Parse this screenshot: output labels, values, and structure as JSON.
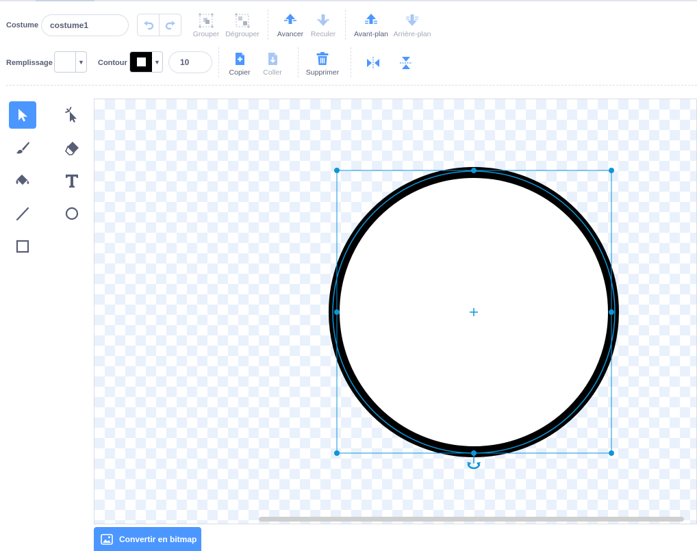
{
  "costume": {
    "label": "Costume",
    "name_value": "costume1"
  },
  "toolbar": {
    "group_label": "Grouper",
    "ungroup_label": "Dégrouper",
    "forward_label": "Avancer",
    "backward_label": "Reculer",
    "front_label": "Avant-plan",
    "back_label": "Arrière-plan",
    "copy_label": "Copier",
    "paste_label": "Coller",
    "delete_label": "Supprimer"
  },
  "fill": {
    "label": "Remplissage",
    "color": "#ffffff"
  },
  "outline": {
    "label": "Contour",
    "color": "#000000",
    "width_value": "10"
  },
  "tools": [
    "select",
    "reshape",
    "brush",
    "eraser",
    "fill",
    "text",
    "line",
    "circle",
    "rectangle"
  ],
  "selected_tool": "select",
  "convert_button": {
    "label": "Convertir en bitmap"
  },
  "colors": {
    "accent": "#4c97ff",
    "selection": "#0f95d6",
    "disabled": "#a3a8b7",
    "text": "#575e75"
  }
}
